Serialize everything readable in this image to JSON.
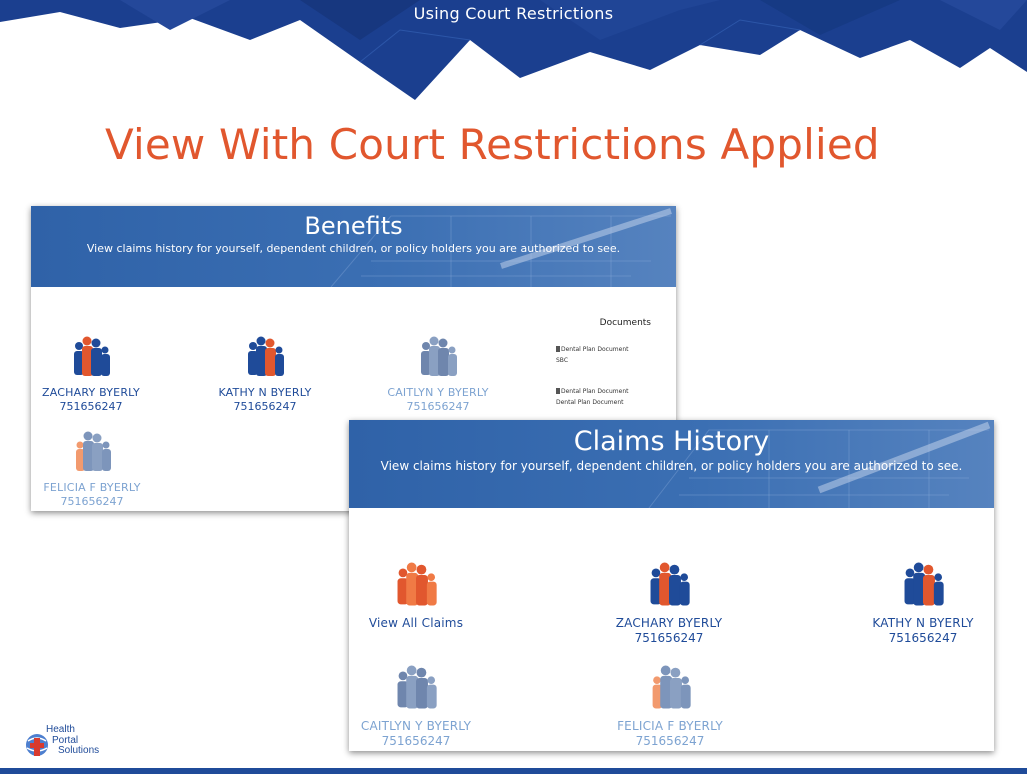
{
  "slide": {
    "header": "Using Court Restrictions",
    "title": "View With Court Restrictions Applied"
  },
  "benefits": {
    "title": "Benefits",
    "subtitle": "View claims history for yourself, dependent children, or policy holders you are authorized to see.",
    "members": [
      {
        "name": "ZACHARY BYERLY",
        "number": "751656247",
        "state": "active",
        "icon": "family-icon-orange-son"
      },
      {
        "name": "KATHY N BYERLY",
        "number": "751656247",
        "state": "active",
        "icon": "family-icon-orange-mom"
      },
      {
        "name": "CAITLYN Y BYERLY",
        "number": "751656247",
        "state": "restricted",
        "icon": "family-icon-grey"
      },
      {
        "name": "FELICIA F BYERLY",
        "number": "751656247",
        "state": "restricted",
        "icon": "family-icon-peach"
      }
    ],
    "documents": {
      "heading": "Documents",
      "items": [
        {
          "label": "Dental Plan Document",
          "sub": "SBC"
        },
        {
          "label": "Dental Plan Document",
          "sub": "Dental Plan Document"
        }
      ]
    }
  },
  "claims": {
    "title": "Claims History",
    "subtitle": "View claims history for yourself, dependent children, or policy holders you are authorized to see.",
    "view_all": "View All Claims",
    "members": [
      {
        "name": "ZACHARY BYERLY",
        "number": "751656247",
        "state": "active"
      },
      {
        "name": "KATHY N BYERLY",
        "number": "751656247",
        "state": "active"
      },
      {
        "name": "CAITLYN Y BYERLY",
        "number": "751656247",
        "state": "restricted"
      },
      {
        "name": "FELICIA F BYERLY",
        "number": "751656247",
        "state": "restricted"
      }
    ]
  },
  "logo": {
    "line1": "Health",
    "line2": "Portal",
    "line3": "Solutions"
  },
  "colors": {
    "accent_orange": "#e1572e",
    "brand_blue": "#1f4b99",
    "restricted_blue": "#7da3d1",
    "banner_navy": "#1b3f8f"
  }
}
